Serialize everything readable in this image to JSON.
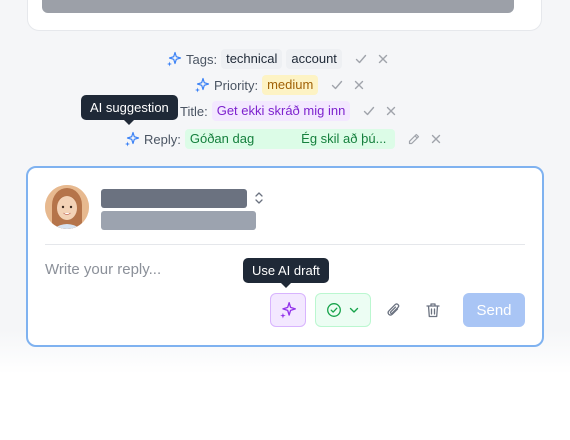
{
  "suggestions": {
    "tags": {
      "label": "Tags:",
      "values": [
        "technical",
        "account"
      ]
    },
    "priority": {
      "label": "Priority:",
      "value": "medium"
    },
    "title": {
      "label": "Title:",
      "value": "Get ekki skráð mig inn"
    },
    "reply": {
      "label": "Reply:",
      "value": "Góðan dag             Ég skil að þú..."
    }
  },
  "tooltips": {
    "ai_suggestion": "AI suggestion",
    "use_ai_draft": "Use AI draft"
  },
  "composer": {
    "placeholder": "Write your reply...",
    "send_label": "Send"
  },
  "colors": {
    "accent_blue": "#3b82f6",
    "ai_purple": "#9333ea",
    "status_green": "#16a34a",
    "send_disabled": "#a9c5f5"
  },
  "icons": {
    "sparkle": "sparkle-icon",
    "accept": "check-icon",
    "reject": "close-icon",
    "edit": "pencil-icon",
    "attach": "paperclip-icon",
    "delete": "trash-icon",
    "status": "check-circle-icon",
    "dropdown": "chevron-down-icon",
    "sort": "chevron-updown-icon"
  }
}
